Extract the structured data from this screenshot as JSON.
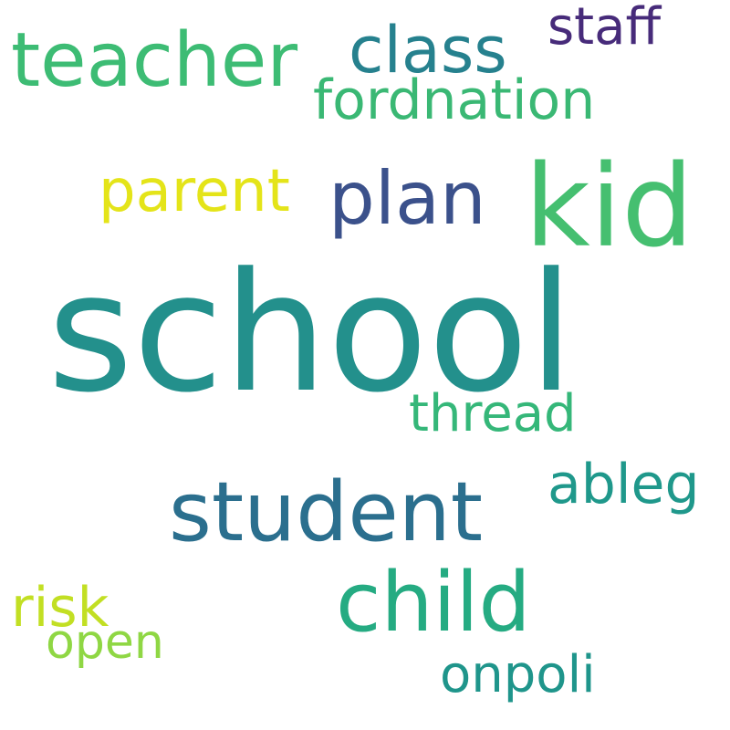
{
  "cloud": {
    "words": [
      {
        "text": "school",
        "color": "#23908c"
      },
      {
        "text": "kid",
        "color": "#45bf70"
      },
      {
        "text": "teacher",
        "color": "#3dbc74"
      },
      {
        "text": "student",
        "color": "#2b6f8e"
      },
      {
        "text": "child",
        "color": "#25ab82"
      },
      {
        "text": "plan",
        "color": "#3b518b"
      },
      {
        "text": "class",
        "color": "#26818e"
      },
      {
        "text": "parent",
        "color": "#e4e419"
      },
      {
        "text": "fordnation",
        "color": "#3ab874"
      },
      {
        "text": "staff",
        "color": "#472b7a"
      },
      {
        "text": "thread",
        "color": "#35b779"
      },
      {
        "text": "ableg",
        "color": "#1f988b"
      },
      {
        "text": "risk",
        "color": "#c2df23"
      },
      {
        "text": "open",
        "color": "#8fd744"
      },
      {
        "text": "onpoli",
        "color": "#1f958b"
      }
    ]
  }
}
